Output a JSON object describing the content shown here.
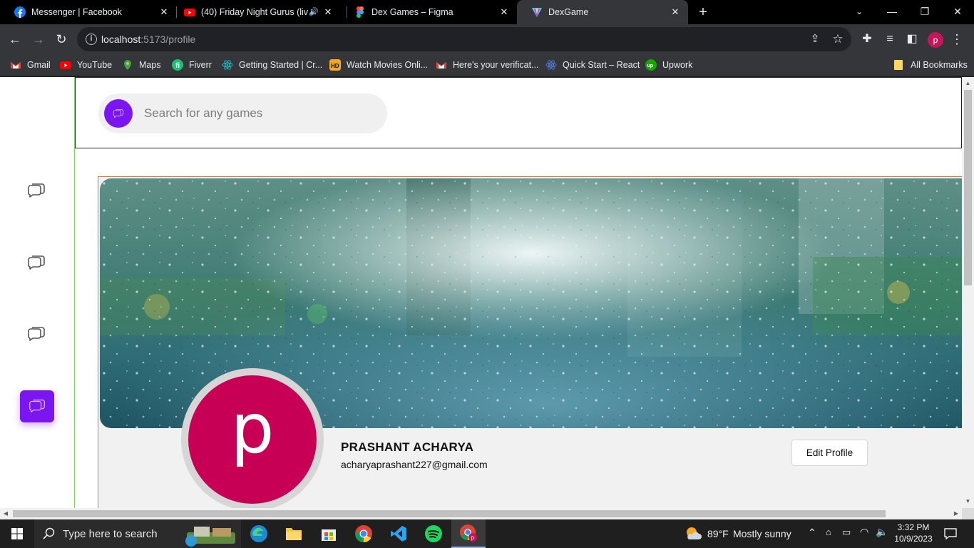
{
  "browser": {
    "tabs": [
      {
        "title": "Messenger | Facebook",
        "icon": "facebook-icon",
        "color": "#1877f2"
      },
      {
        "title": "(40) Friday Night Gurus (live",
        "icon": "youtube-icon",
        "color": "#ff0000"
      },
      {
        "title": "Dex Games – Figma",
        "icon": "figma-icon",
        "color": "#a259ff"
      },
      {
        "title": "DexGame",
        "icon": "vite-icon",
        "color": "#bd34fe",
        "active": true
      }
    ],
    "url_host": "localhost",
    "url_path": ":5173/profile",
    "profile_initial": "p",
    "bookmarks": [
      {
        "label": "Gmail",
        "icon": "gmail-icon"
      },
      {
        "label": "YouTube",
        "icon": "youtube-icon"
      },
      {
        "label": "Maps",
        "icon": "maps-icon"
      },
      {
        "label": "Fiverr",
        "icon": "fiverr-icon"
      },
      {
        "label": "Getting Started | Cr...",
        "icon": "react-icon"
      },
      {
        "label": "Watch Movies Onli...",
        "icon": "hd-icon"
      },
      {
        "label": "Here's your verificat...",
        "icon": "gmail-icon"
      },
      {
        "label": "Quick Start – React",
        "icon": "react-icon"
      },
      {
        "label": "Upwork",
        "icon": "upwork-icon"
      }
    ],
    "all_bookmarks": "All Bookmarks"
  },
  "app": {
    "search_placeholder": "Search for any games",
    "accent": "#7b16f2",
    "profile": {
      "name": "PRASHANT ACHARYA",
      "email": "acharyaprashant227@gmail.com",
      "avatar_initial": "p",
      "avatar_color": "#c70056",
      "edit_label": "Edit Profile"
    }
  },
  "taskbar": {
    "search_placeholder": "Type here to search",
    "weather_temp": "89°F",
    "weather_text": "Mostly sunny",
    "time": "3:32 PM",
    "date": "10/9/2023"
  }
}
